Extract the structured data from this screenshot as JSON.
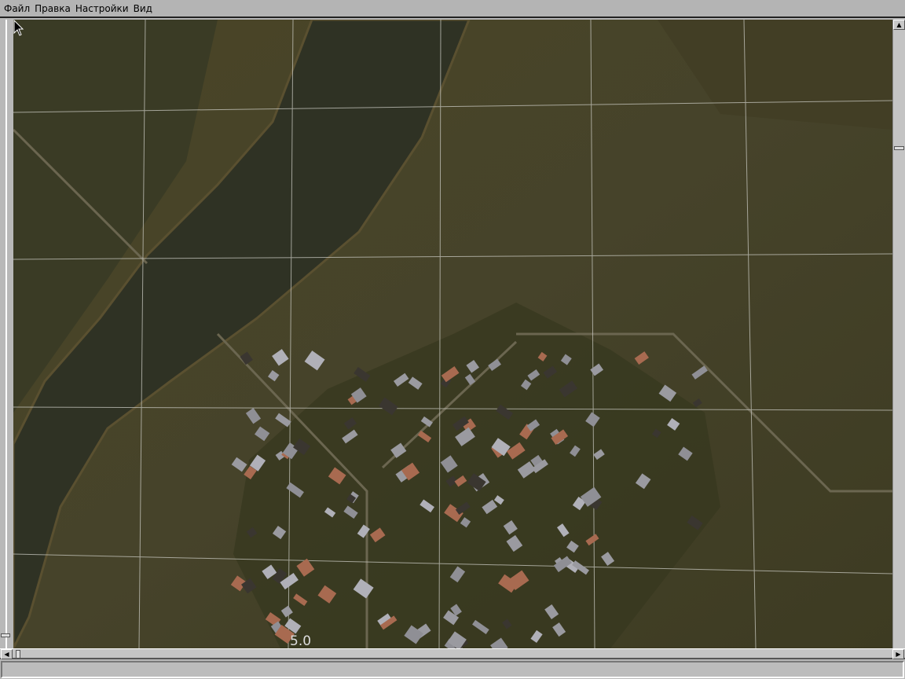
{
  "menu": {
    "items": [
      "Файл",
      "Правка",
      "Настройки",
      "Вид"
    ]
  },
  "map": {
    "grid_label": "5.0",
    "cursor_icon": "arrow-cursor-icon"
  },
  "scrollbars": {
    "up_arrow": "▲",
    "left_arrow": "◀",
    "right_arrow": "▶"
  },
  "status": {
    "text": ""
  }
}
